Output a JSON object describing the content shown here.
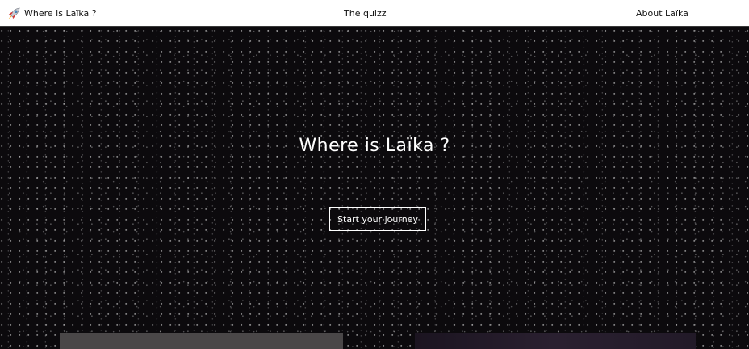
{
  "nav": {
    "brand_label": "Where is Laïka ?",
    "brand_icon": "rocket-icon",
    "links": [
      {
        "label": "The quizz"
      },
      {
        "label": "About Laïka"
      }
    ]
  },
  "hero": {
    "title": "Where is Laïka ?",
    "cta_label": "Start your journey"
  },
  "colors": {
    "nav_bg": "#ffffff",
    "hero_bg": "#0c0a0d",
    "text_light": "#ffffff",
    "text_dark": "#111111"
  }
}
